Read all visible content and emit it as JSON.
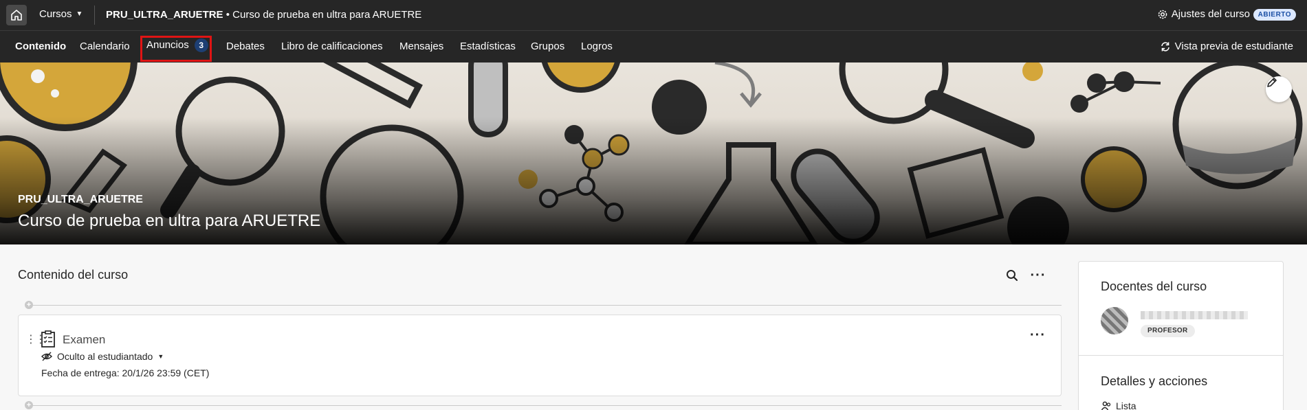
{
  "topbar": {
    "courses_label": "Cursos",
    "course_code": "PRU_ULTRA_ARUETRE",
    "course_separator": " • ",
    "course_name": "Curso de prueba en ultra para ARUETRE",
    "settings_label": "Ajustes del curso",
    "status_badge": "ABIERTO"
  },
  "nav": {
    "tabs": [
      {
        "label": "Contenido"
      },
      {
        "label": "Calendario"
      },
      {
        "label": "Anuncios",
        "count": "3"
      },
      {
        "label": "Debates"
      },
      {
        "label": "Libro de calificaciones"
      },
      {
        "label": "Mensajes"
      },
      {
        "label": "Estadísticas"
      },
      {
        "label": "Grupos"
      },
      {
        "label": "Logros"
      }
    ],
    "student_preview_label": "Vista previa de estudiante"
  },
  "banner": {
    "course_code": "PRU_ULTRA_ARUETRE",
    "course_name": "Curso de prueba en ultra para ARUETRE"
  },
  "content": {
    "title": "Contenido del curso",
    "items": [
      {
        "title": "Examen",
        "visibility": "Oculto al estudiantado",
        "due": "Fecha de entrega: 20/1/26 23:59 (CET)"
      }
    ]
  },
  "sidebar": {
    "teachers_title": "Docentes del curso",
    "teacher_role": "PROFESOR",
    "details_title": "Detalles y acciones",
    "list_label": "Lista"
  },
  "colors": {
    "topbar_bg": "#262626",
    "highlight_border": "#e01414",
    "count_badge_bg": "#1e3f73",
    "status_badge_bg": "#dbe8ff"
  }
}
